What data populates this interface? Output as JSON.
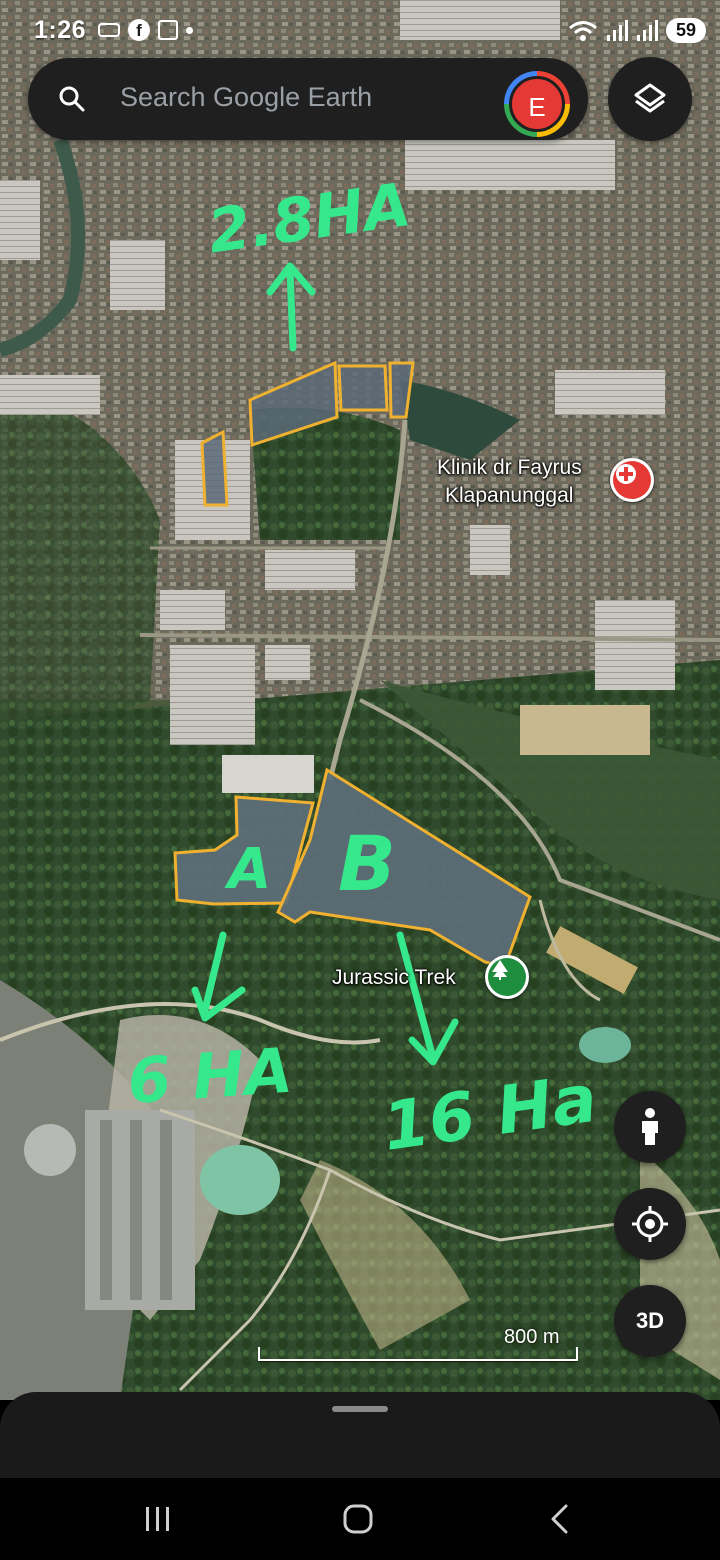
{
  "status_bar": {
    "time": "1:26",
    "facebook_glyph": "f",
    "battery": "59",
    "icons": [
      "voicemail-icon",
      "facebook-icon",
      "gallery-icon",
      "wifi-icon",
      "signal-icon",
      "signal-icon"
    ]
  },
  "search": {
    "placeholder": "Search Google Earth",
    "avatar_letter": "E"
  },
  "map": {
    "places": [
      {
        "name": "Klinik dr Fayrus",
        "name_line2": "Klapanunggal",
        "type": "hospital",
        "color": "#e53935"
      },
      {
        "name": "Jurassic Trek",
        "type": "park",
        "color": "#1e8e3e"
      }
    ],
    "annotations": {
      "color": "#35e88b",
      "outline_color": "#f0b030",
      "top_area": "2.8HA",
      "label_a": "A",
      "label_b": "B",
      "area_a": "6 HA",
      "area_b": "16 Ha"
    },
    "scale": "800 m"
  },
  "controls": {
    "pegman_icon": "pegman-icon",
    "location_icon": "my-location-icon",
    "view_3d": "3D"
  },
  "nav": {
    "icons": [
      "recents-icon",
      "home-icon",
      "back-icon"
    ]
  }
}
